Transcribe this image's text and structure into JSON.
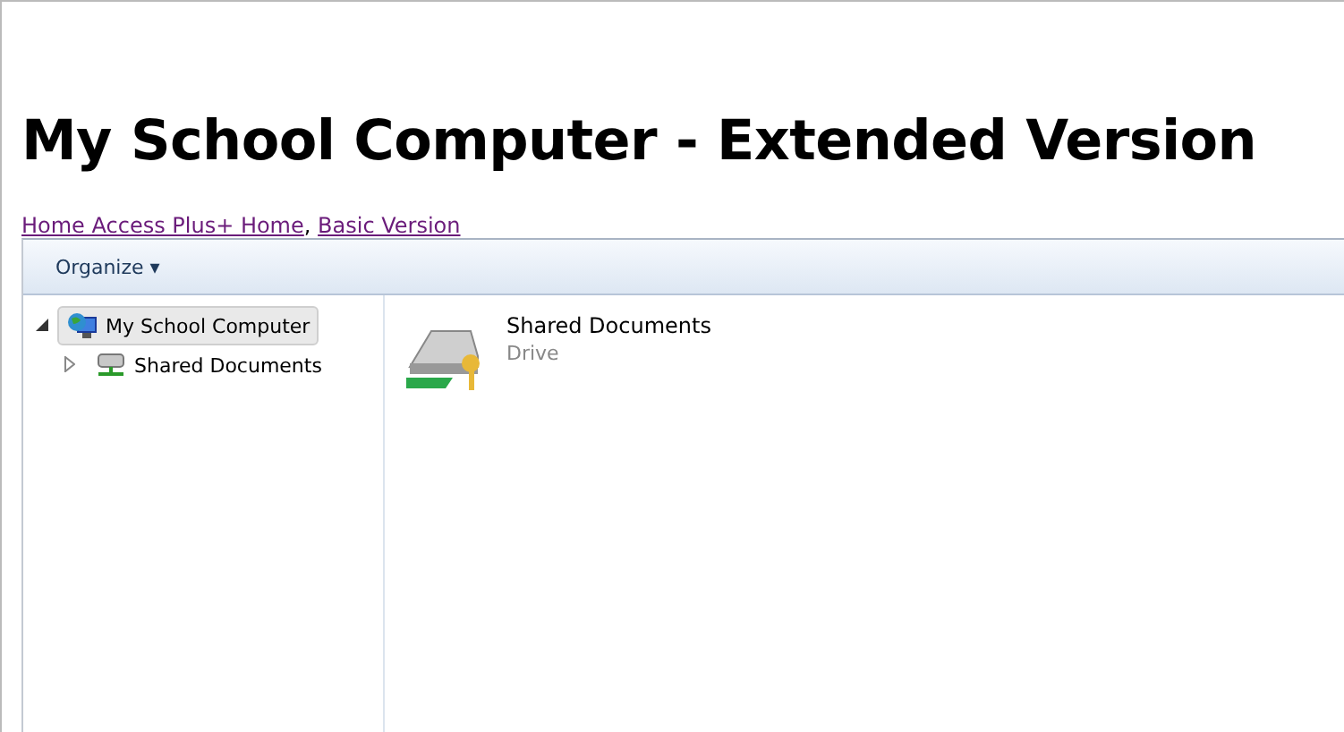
{
  "title": "My School Computer - Extended Version",
  "links": [
    {
      "label": "Home Access Plus+ Home"
    },
    {
      "label": "Basic Version"
    }
  ],
  "links_separator": ",",
  "toolbar": {
    "menu": "Organize ▾"
  },
  "tree": [
    {
      "label": "My School Computer",
      "selected": true,
      "expanded": true,
      "children": [
        {
          "label": "Shared Documents",
          "selected": false,
          "expanded": false
        }
      ]
    }
  ],
  "items": [
    {
      "name": "Shared Documents",
      "type": "Drive"
    }
  ]
}
